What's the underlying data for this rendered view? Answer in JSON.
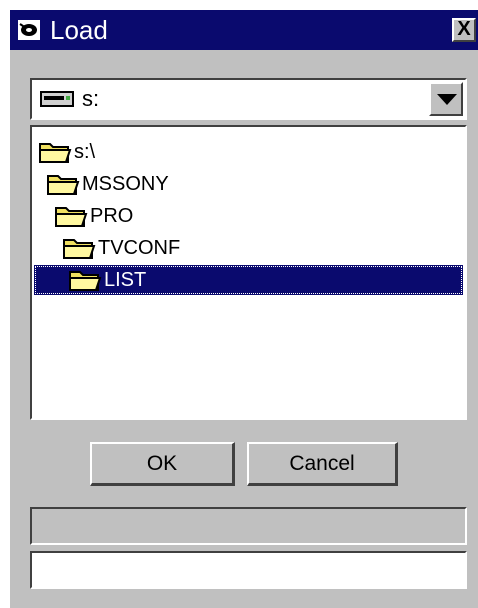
{
  "window": {
    "title": "Load",
    "close_label": "X",
    "title_icon": "load-disk-icon"
  },
  "drive_select": {
    "value": "s:",
    "icon": "drive-icon"
  },
  "folder_tree": {
    "items": [
      {
        "label": "s:\\",
        "icon": "open-folder-icon",
        "selected": false
      },
      {
        "label": "MSSONY",
        "icon": "open-folder-icon",
        "selected": false
      },
      {
        "label": "PRO",
        "icon": "open-folder-icon",
        "selected": false
      },
      {
        "label": "TVCONF",
        "icon": "open-folder-icon",
        "selected": false
      },
      {
        "label": "LIST",
        "icon": "open-folder-icon",
        "selected": true
      }
    ]
  },
  "buttons": {
    "ok": "OK",
    "cancel": "Cancel"
  },
  "status_text": "",
  "filename_value": "",
  "colors": {
    "titlebar": "#0a0a6e",
    "face": "#c0c0c0",
    "selection": "#0a0a6e",
    "folder": "#f0e060"
  }
}
